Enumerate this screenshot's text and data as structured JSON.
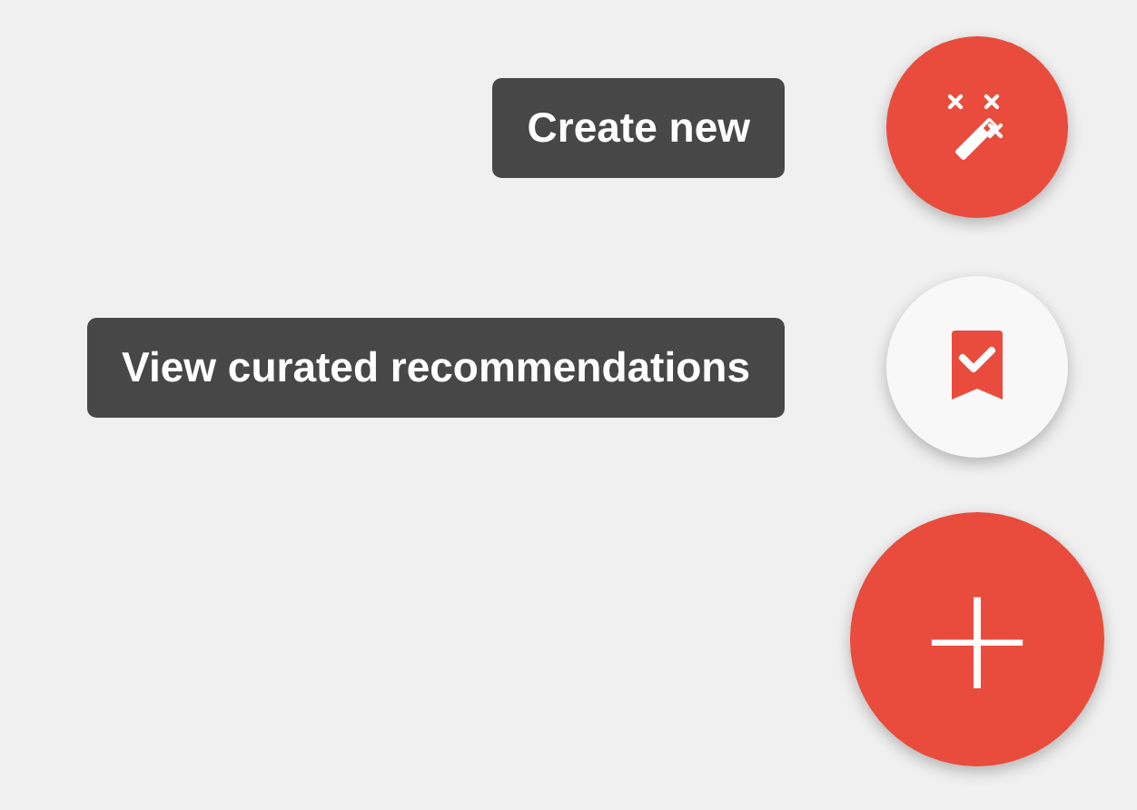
{
  "speed_dial": {
    "actions": [
      {
        "label": "Create new",
        "kind": "magic"
      },
      {
        "label": "View curated recommendations",
        "kind": "bookmark"
      }
    ],
    "main_button": {
      "icon": "+"
    }
  }
}
